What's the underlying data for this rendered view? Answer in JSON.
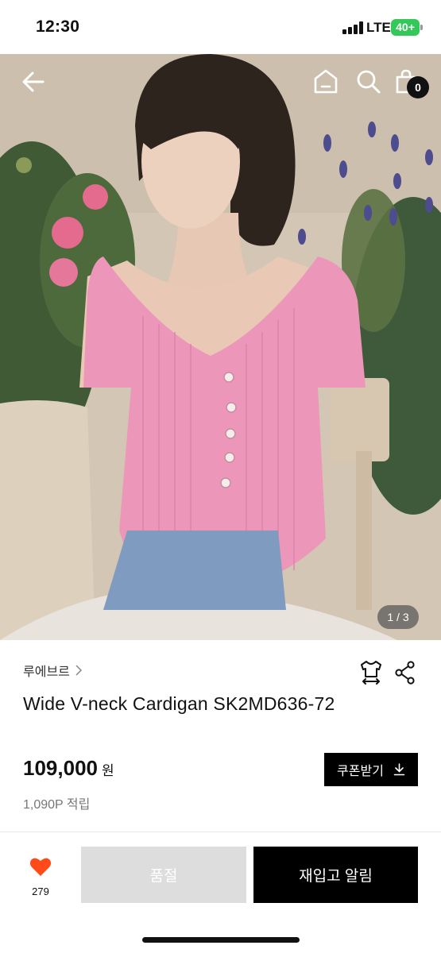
{
  "status_bar": {
    "time": "12:30",
    "network": "LTE",
    "battery": "40+"
  },
  "hero": {
    "image_counter": "1 / 3",
    "cart_count": "0",
    "icons": [
      "back-arrow-icon",
      "home-icon",
      "search-icon",
      "cart-icon"
    ]
  },
  "product": {
    "brand": "루에브르",
    "title": "Wide V-neck Cardigan SK2MD636-72",
    "price": "109,000",
    "currency": "원",
    "points": "1,090P 적립",
    "coupon_label": "쿠폰받기"
  },
  "actions": {
    "like_count": "279",
    "soldout_label": "품절",
    "restock_label": "재입고 알림"
  },
  "colors": {
    "accent_heart": "#ff4a1a",
    "primary_button": "#000000",
    "disabled_button": "#dddddd",
    "battery": "#34c759"
  }
}
